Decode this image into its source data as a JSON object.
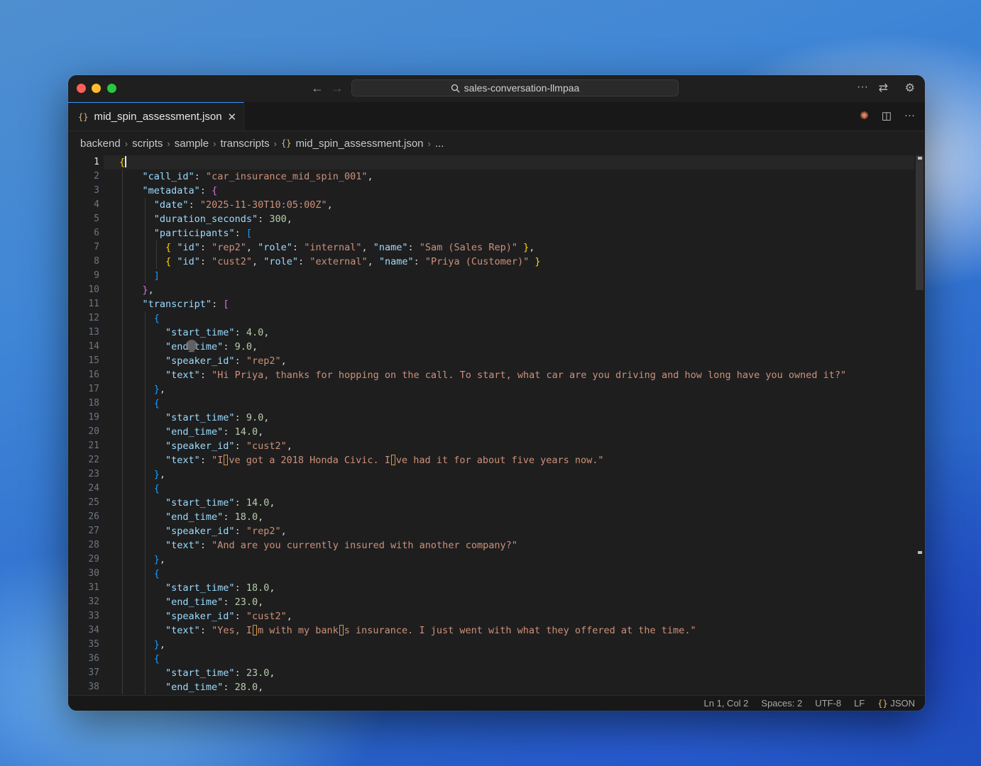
{
  "titlebar": {
    "search_text": "sales-conversation-llmpaa",
    "back_icon": "arrow-left-icon",
    "forward_icon": "arrow-right-icon"
  },
  "tab": {
    "file_name": "mid_spin_assessment.json",
    "icon": "json-braces-icon"
  },
  "breadcrumb": [
    "backend",
    "scripts",
    "sample",
    "transcripts",
    "mid_spin_assessment.json",
    "..."
  ],
  "editor": {
    "active_line": 1,
    "line_numbers": [
      "1",
      "2",
      "3",
      "4",
      "5",
      "6",
      "7",
      "8",
      "9",
      "10",
      "11",
      "12",
      "13",
      "14",
      "15",
      "16",
      "17",
      "18",
      "19",
      "20",
      "21",
      "22",
      "23",
      "24",
      "25",
      "26",
      "27",
      "28",
      "29",
      "30",
      "31",
      "32",
      "33",
      "34",
      "35",
      "36",
      "37",
      "38"
    ],
    "code": {
      "call_id": "car_insurance_mid_spin_001",
      "date": "2025-11-30T10:05:00Z",
      "duration_seconds": "300",
      "participants": [
        {
          "id": "rep2",
          "role": "internal",
          "name": "Sam (Sales Rep)"
        },
        {
          "id": "cust2",
          "role": "external",
          "name": "Priya (Customer)"
        }
      ],
      "transcript": [
        {
          "start_time": "4.0",
          "end_time": "9.0",
          "speaker_id": "rep2",
          "text": "Hi Priya, thanks for hopping on the call. To start, what car are you driving and how long have you owned it?"
        },
        {
          "start_time": "9.0",
          "end_time": "14.0",
          "speaker_id": "cust2",
          "text_parts": [
            "I",
            "ve got a 2018 Honda Civic. I",
            "ve had it for about five years now."
          ]
        },
        {
          "start_time": "14.0",
          "end_time": "18.0",
          "speaker_id": "rep2",
          "text": "And are you currently insured with another company?"
        },
        {
          "start_time": "18.0",
          "end_time": "23.0",
          "speaker_id": "cust2",
          "text_parts": [
            "Yes, I",
            "m with my bank",
            "s insurance. I just went with what they offered at the time."
          ]
        },
        {
          "start_time": "23.0",
          "end_time": "28.0"
        }
      ]
    }
  },
  "statusbar": {
    "position": "Ln 1, Col 2",
    "spaces": "Spaces: 2",
    "encoding": "UTF-8",
    "eol": "LF",
    "language": "JSON"
  }
}
